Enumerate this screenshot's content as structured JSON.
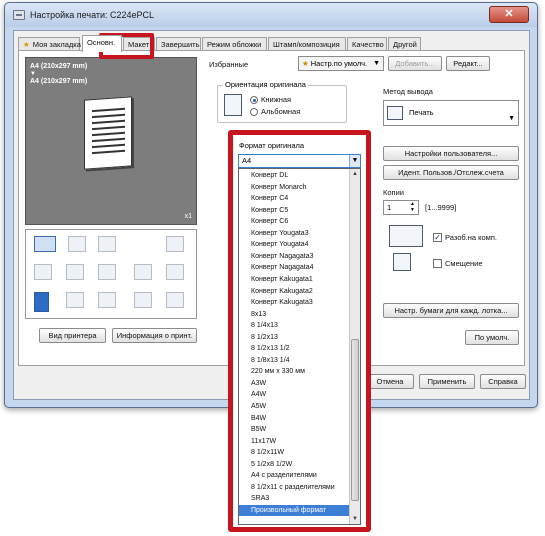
{
  "window": {
    "title": "Настройка печати: C224ePCL",
    "close_glyph": "✕"
  },
  "tabs": [
    {
      "label": "Моя закладка",
      "star": "★"
    },
    {
      "label": "Основн."
    },
    {
      "label": "Макет"
    },
    {
      "label": "Завершить"
    },
    {
      "label": "Режим обложки"
    },
    {
      "label": "Штамп/композиция"
    },
    {
      "label": "Качество"
    },
    {
      "label": "Другой"
    }
  ],
  "preview": {
    "line1": "A4 (210x297 mm)",
    "arrow": "▼",
    "line2": "A4 (210x297 mm)",
    "copies_badge": "x1"
  },
  "favorites": {
    "label": "Избранные",
    "value": "Настр.по умолч.",
    "add_button": "Добавить...",
    "edit_button": "Редакт..."
  },
  "orientation": {
    "title": "Ориентация оригинала",
    "portrait": "Книжная",
    "landscape": "Альбомная",
    "selected": "portrait"
  },
  "output": {
    "title": "Метод вывода",
    "value": "Печать"
  },
  "buttons": {
    "user_settings": "Настройки пользователя...",
    "user_auth": "Идент. Пользов./Отслеж.счета",
    "paper_per_tray": "Настр. бумаги для кажд. лотка...",
    "defaults": "По умолч.",
    "printer_view": "Вид принтера",
    "printer_info": "Информация о принт.",
    "cancel": "Отмена",
    "apply": "Применить",
    "help": "Справка"
  },
  "copies": {
    "label": "Копии",
    "value": "1",
    "range": "[1...9999]"
  },
  "collate": {
    "label": "Разоб.на комп.",
    "checked": true
  },
  "offset": {
    "label": "Смещение",
    "checked": false
  },
  "original_size": {
    "label": "Формат оригинала",
    "value": "A4",
    "options": [
      "Конверт DL",
      "Конверт Monarch",
      "Конверт C4",
      "Конверт C5",
      "Конверт C6",
      "Конверт Yougata3",
      "Конверт Yougata4",
      "Конверт Nagagata3",
      "Конверт Nagagata4",
      "Конверт Kakugata1",
      "Конверт Kakugata2",
      "Конверт Kakugata3",
      "8x13",
      "8 1/4x13",
      "8 1/2x13",
      "8 1/2x13 1/2",
      "8 1/8x13 1/4",
      "220 мм x 330 мм",
      "A3W",
      "A4W",
      "A5W",
      "B4W",
      "B5W",
      "11x17W",
      "8 1/2x11W",
      "5 1/2x8 1/2W",
      "A4 с разделителями",
      "8 1/2x11 с разделителями",
      "SRA3",
      "Произвольный формат"
    ],
    "selected_option": "Произвольный формат"
  },
  "colors": {
    "highlight": "#c8141e",
    "selection": "#3d7fd6"
  }
}
